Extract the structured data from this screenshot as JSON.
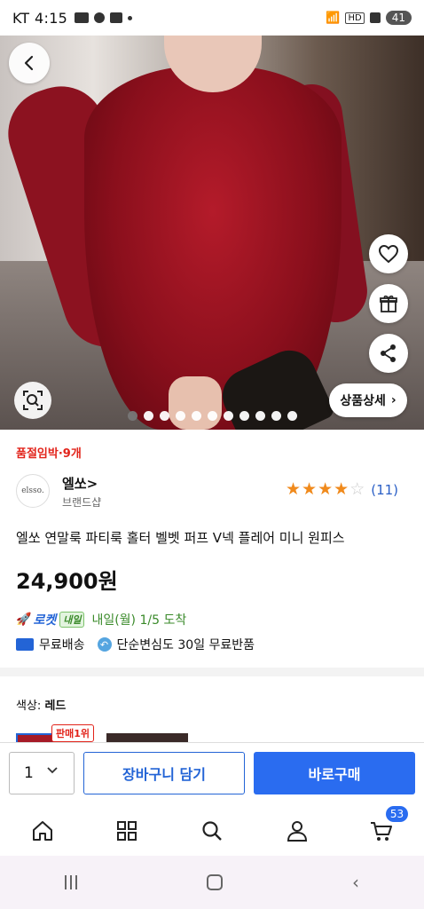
{
  "status_bar": {
    "carrier": "KT",
    "time": "4:15",
    "hd": "HD",
    "battery": "41"
  },
  "hero": {
    "detail_button": "상품상세",
    "dots_total": 11,
    "active_dot": 0
  },
  "product": {
    "urgency": "품절임박·9개",
    "brand_logo": "elsso.",
    "brand_name": "엘쏘>",
    "brand_sub": "브랜드샵",
    "rating_stars": 4,
    "rating_count": "(11)",
    "title": "엘쏘 연말룩 파티룩 홀터 벨벳 퍼프 V넥 플레어 미니 원피스",
    "price": "24,900원",
    "rocket_label": "로켓",
    "rocket_badge": "내일",
    "arrival": "내일(월) 1/5 도착",
    "free_shipping": "무료배송",
    "free_return": "단순변심도 30일 무료반품",
    "color_prefix": "색상: ",
    "color_value": "레드",
    "best_badge": "판매1위"
  },
  "purchase": {
    "quantity": "1",
    "add_to_cart": "장바구니 담기",
    "buy_now": "바로구매"
  },
  "nav": {
    "cart_count": "53"
  },
  "colors": {
    "accent_blue": "#2a6cf0",
    "urgency_red": "#e2231a",
    "star_orange": "#f08a1c"
  }
}
